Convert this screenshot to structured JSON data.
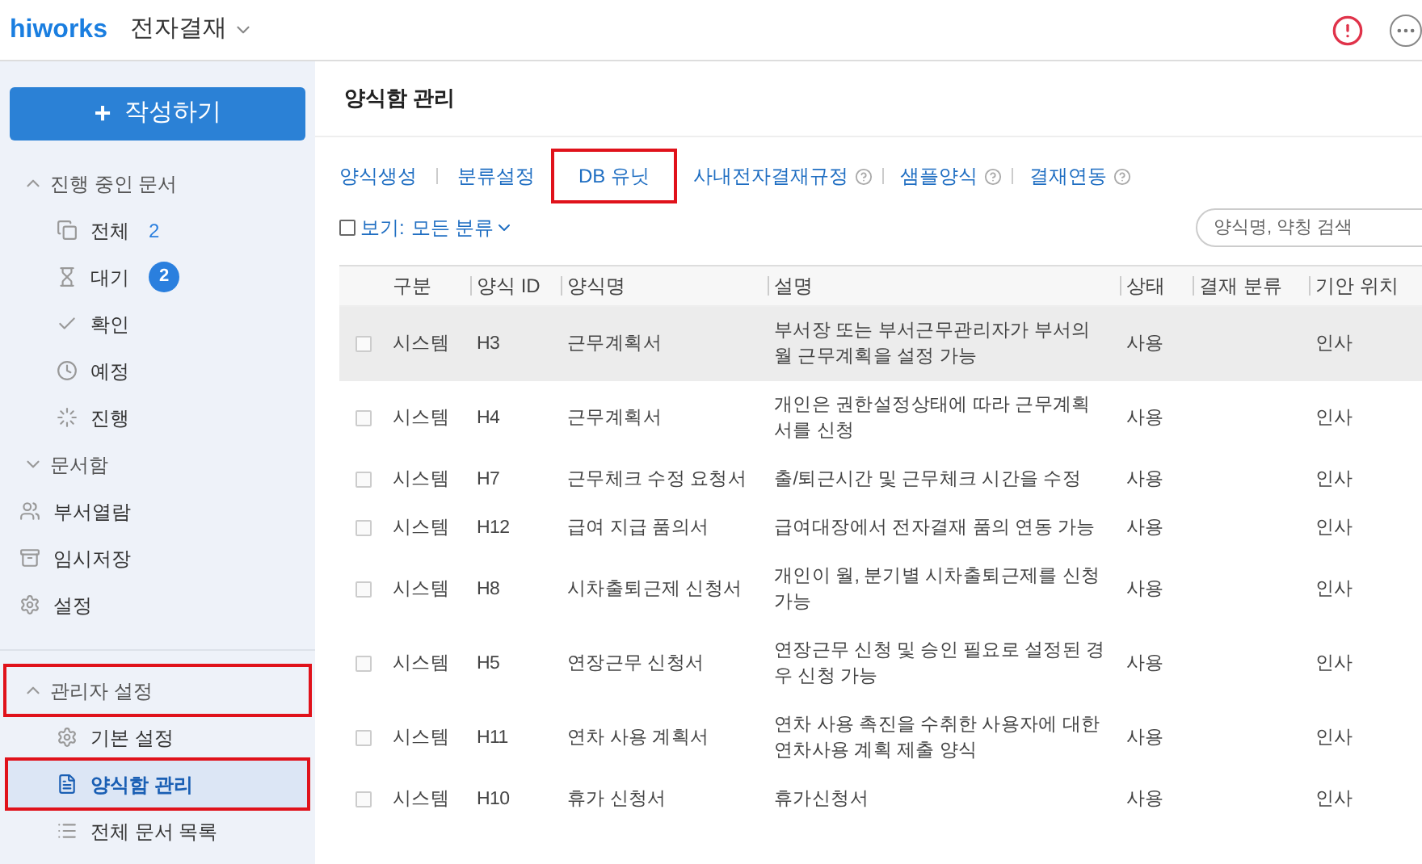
{
  "header": {
    "logo": "hiworks",
    "app": "전자결재"
  },
  "sidebar": {
    "compose": {
      "icon": "+",
      "label": "작성하기"
    },
    "sections": [
      {
        "title": "진행 중인 문서",
        "expanded": true,
        "highlighted": false,
        "items": [
          {
            "kind": "count",
            "label": "전체",
            "count": "2",
            "selected": false,
            "highlighted": false
          },
          {
            "kind": "badge",
            "label": "대기",
            "count": "2",
            "selected": false,
            "highlighted": false
          },
          {
            "label": "확인",
            "selected": false,
            "highlighted": false
          },
          {
            "label": "예정",
            "selected": false,
            "highlighted": false
          },
          {
            "label": "진행",
            "selected": false,
            "highlighted": false
          }
        ]
      },
      {
        "title": "문서함",
        "expanded": false,
        "highlighted": false
      }
    ],
    "links": [
      {
        "label": "부서열람"
      },
      {
        "label": "임시저장"
      },
      {
        "label": "설정"
      }
    ],
    "admin": {
      "title": "관리자 설정",
      "expanded": true,
      "highlighted": true,
      "items": [
        {
          "label": "기본 설정",
          "selected": false,
          "highlighted": false
        },
        {
          "label": "양식함 관리",
          "selected": true,
          "highlighted": true
        },
        {
          "label": "전체 문서 목록",
          "selected": false,
          "highlighted": false
        }
      ]
    }
  },
  "page": {
    "title": "양식함 관리",
    "tabs": [
      {
        "label": "양식생성",
        "help": false,
        "highlighted": false
      },
      {
        "label": "분류설정",
        "help": false,
        "highlighted": false
      },
      {
        "label": "DB 유닛",
        "help": false,
        "highlighted": true
      },
      {
        "label": "사내전자결재규정",
        "help": true,
        "highlighted": false
      },
      {
        "label": "샘플양식",
        "help": true,
        "highlighted": false
      },
      {
        "label": "결재연동",
        "help": true,
        "highlighted": false
      }
    ],
    "filter": {
      "checked": false,
      "label": "보기:",
      "value": "모든 분류"
    },
    "search": {
      "placeholder": "양식명, 약칭 검색"
    }
  },
  "table": {
    "columns": [
      "구분",
      "양식 ID",
      "양식명",
      "설명",
      "상태",
      "결재 분류",
      "기안 위치"
    ],
    "rows": [
      {
        "checked": false,
        "highlighted": true,
        "cells": [
          "시스템",
          "H3",
          "근무계획서",
          "부서장 또는 부서근무관리자가 부서의 월 근무계획을 설정 가능",
          "사용",
          "",
          "인사"
        ]
      },
      {
        "checked": false,
        "highlighted": false,
        "cells": [
          "시스템",
          "H4",
          "근무계획서",
          "개인은 권한설정상태에 따라 근무계획서를 신청",
          "사용",
          "",
          "인사"
        ]
      },
      {
        "checked": false,
        "highlighted": false,
        "cells": [
          "시스템",
          "H7",
          "근무체크 수정 요청서",
          "출/퇴근시간 및 근무체크 시간을 수정",
          "사용",
          "",
          "인사"
        ]
      },
      {
        "checked": false,
        "highlighted": false,
        "cells": [
          "시스템",
          "H12",
          "급여 지급 품의서",
          "급여대장에서 전자결재 품의 연동 가능",
          "사용",
          "",
          "인사"
        ]
      },
      {
        "checked": false,
        "highlighted": false,
        "cells": [
          "시스템",
          "H8",
          "시차출퇴근제 신청서",
          "개인이 월, 분기별 시차출퇴근제를 신청 가능",
          "사용",
          "",
          "인사"
        ]
      },
      {
        "checked": false,
        "highlighted": false,
        "cells": [
          "시스템",
          "H5",
          "연장근무 신청서",
          "연장근무 신청 및 승인 필요로 설정된 경우 신청 가능",
          "사용",
          "",
          "인사"
        ]
      },
      {
        "checked": false,
        "highlighted": false,
        "cells": [
          "시스템",
          "H11",
          "연차 사용 계획서",
          "연차 사용 촉진을 수취한 사용자에 대한 연차사용 계획 제출 양식",
          "사용",
          "",
          "인사"
        ]
      },
      {
        "checked": false,
        "highlighted": false,
        "cells": [
          "시스템",
          "H10",
          "휴가 신청서",
          "휴가신청서",
          "사용",
          "",
          "인사"
        ]
      }
    ]
  }
}
